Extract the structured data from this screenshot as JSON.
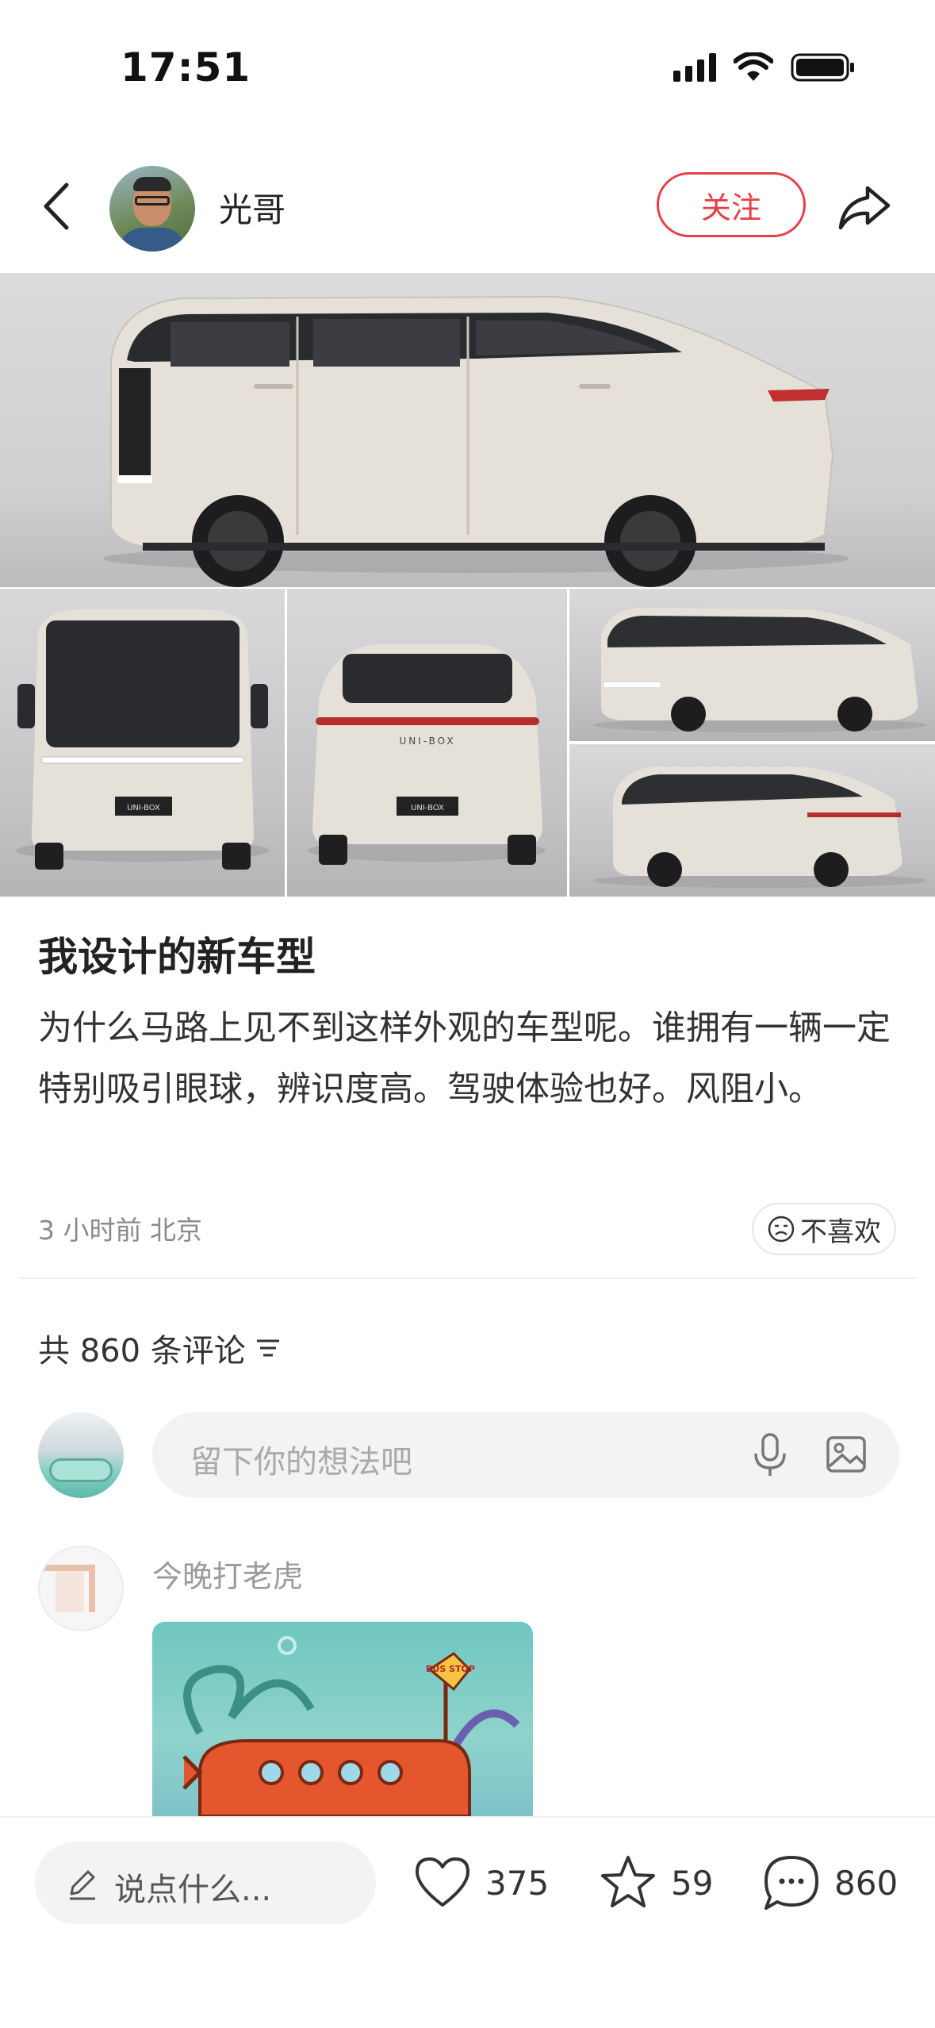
{
  "status_bar": {
    "time": "17:51"
  },
  "header": {
    "author_name": "光哥",
    "follow_label": "关注"
  },
  "post": {
    "title": "我设计的新车型",
    "body": "为什么马路上见不到这样外观的车型呢。谁拥有一辆一定特别吸引眼球，辨识度高。驾驶体验也好。风阻小。",
    "meta": "3 小时前 北京",
    "dislike_label": "不喜欢",
    "car_badge_text": "UNI-BOX"
  },
  "comments": {
    "count_text": "共 860 条评论",
    "input_placeholder": "留下你的想法吧",
    "first_comment": {
      "author": "今晚打老虎",
      "image_sign_text": "BUS STOP"
    }
  },
  "bottom_bar": {
    "input_placeholder": "说点什么...",
    "likes": "375",
    "favorites": "59",
    "comments": "860"
  },
  "colors": {
    "accent_red": "#e4404a",
    "car_body": "#e6e1d8"
  },
  "icons": [
    "back-arrow-icon",
    "share-icon",
    "dislike-face-icon",
    "sort-icon",
    "mic-icon",
    "image-icon",
    "pen-icon",
    "heart-icon",
    "star-icon",
    "comment-bubble-icon"
  ]
}
